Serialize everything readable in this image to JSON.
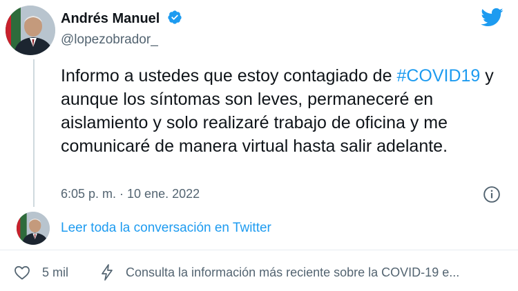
{
  "author": {
    "name": "Andrés Manuel",
    "handle": "@lopezobrador_",
    "verified": true
  },
  "tweet": {
    "text_before": "Informo a ustedes que estoy contagiado de ",
    "hashtag": "#COVID19",
    "text_after": " y aunque los síntomas son leves, permaneceré en aislamiento y solo realizaré trabajo de oficina y me comunicaré de manera virtual hasta salir adelante.",
    "timestamp": "6:05 p. m. · 10 ene. 2022"
  },
  "conversation_link": "Leer toda la conversación en Twitter",
  "footer": {
    "likes": "5 mil",
    "covid_info": "Consulta la información más reciente sobre la COVID-19 e..."
  },
  "icons": {
    "brand": "twitter-bird-icon",
    "verified": "verified-badge-icon",
    "info": "info-icon",
    "like": "heart-icon",
    "covid": "lightning-bolt-icon"
  },
  "colors": {
    "accent": "#1d9bf0",
    "text": "#0f1419",
    "secondary": "#536471",
    "thread_line": "#cfd9de"
  }
}
